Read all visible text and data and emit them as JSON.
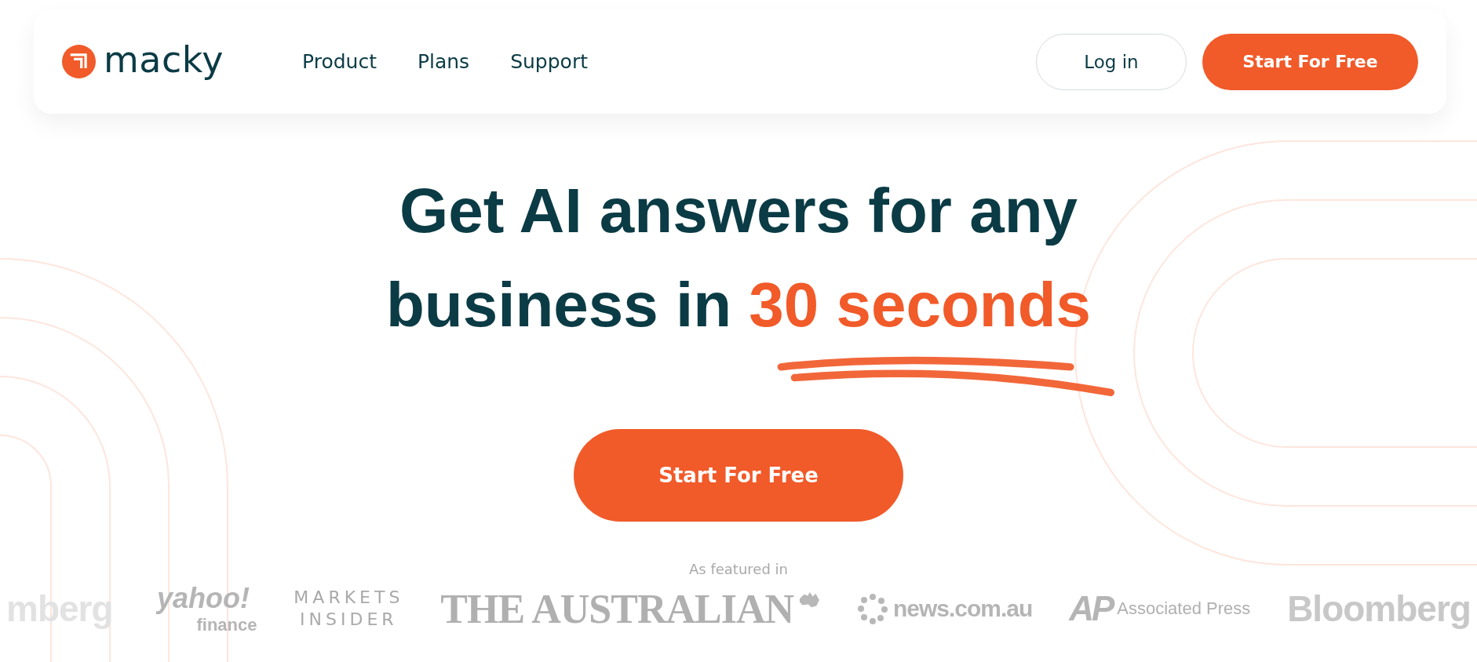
{
  "header": {
    "brand": "macky",
    "nav": [
      {
        "label": "Product"
      },
      {
        "label": "Plans"
      },
      {
        "label": "Support"
      }
    ],
    "login": "Log in",
    "cta": "Start For Free"
  },
  "hero": {
    "line1": "Get AI answers for any",
    "line2": "business in",
    "highlight": "30 seconds",
    "cta": "Start For Free"
  },
  "featured": {
    "label": "As featured in",
    "logos": [
      {
        "kind": "faded-left",
        "texts": [
          "mberg"
        ]
      },
      {
        "kind": "yahoo",
        "texts": [
          "yahoo!",
          "finance"
        ]
      },
      {
        "kind": "markets",
        "texts": [
          "MARKETS",
          "INSIDER"
        ]
      },
      {
        "kind": "australian",
        "texts": [
          "THE AUSTRALIAN"
        ]
      },
      {
        "kind": "news",
        "texts": [
          "news.com.au"
        ]
      },
      {
        "kind": "ap",
        "texts": [
          "AP",
          "Associated Press"
        ]
      },
      {
        "kind": "faded-right",
        "texts": [
          "Bloomberg"
        ]
      }
    ]
  }
}
